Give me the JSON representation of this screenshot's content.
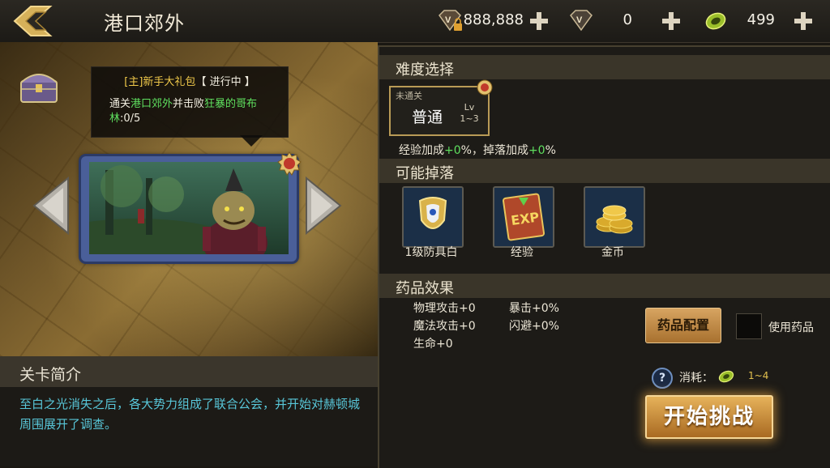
{
  "header": {
    "title": "港口郊外",
    "currencies": [
      {
        "icon": "v-gem-locked-icon",
        "value": "888,888"
      },
      {
        "icon": "v-gem-icon",
        "value": "0"
      },
      {
        "icon": "stamina-coin-icon",
        "value": "499"
      }
    ]
  },
  "quest": {
    "tag": "[主]新手大礼包",
    "status": "【 进行中 】",
    "text_prefix": "通关",
    "location": "港口郊外",
    "text_mid": "并击败",
    "target": "狂暴的哥布林",
    "progress": ":0/5"
  },
  "intro": {
    "title": "关卡简介",
    "text": "至白之光消失之后，各大势力组成了联合公会，并开始对赫顿城周围展开了调查。"
  },
  "difficulty": {
    "section_title": "难度选择",
    "status": "未通关",
    "name": "普通",
    "lv_label": "Lv",
    "lv_range": "1~3",
    "bonus_exp_label": "经验加成",
    "bonus_exp_value": "+0",
    "bonus_exp_suffix": "%，",
    "bonus_drop_label": "掉落加成",
    "bonus_drop_value": "+0",
    "bonus_drop_suffix": "%"
  },
  "drops": {
    "section_title": "可能掉落",
    "items": [
      {
        "icon": "armor-icon",
        "label": "1级防具白"
      },
      {
        "icon": "exp-book-icon",
        "label": "经验"
      },
      {
        "icon": "gold-coins-icon",
        "label": "金币"
      }
    ]
  },
  "potions": {
    "section_title": "药品效果",
    "stats": [
      "物理攻击+0",
      "魔法攻击+0",
      "生命+0",
      "暴击+0%",
      "闪避+0%"
    ],
    "config_button": "药品配置",
    "use_label": "使用药品"
  },
  "footer": {
    "cost_label": "消耗：",
    "cost_value": "1~4",
    "start_button": "开始挑战"
  },
  "colors": {
    "accent_gold": "#f0c94a",
    "highlight_green": "#5fe05f",
    "intro_text": "#58c6d8"
  }
}
